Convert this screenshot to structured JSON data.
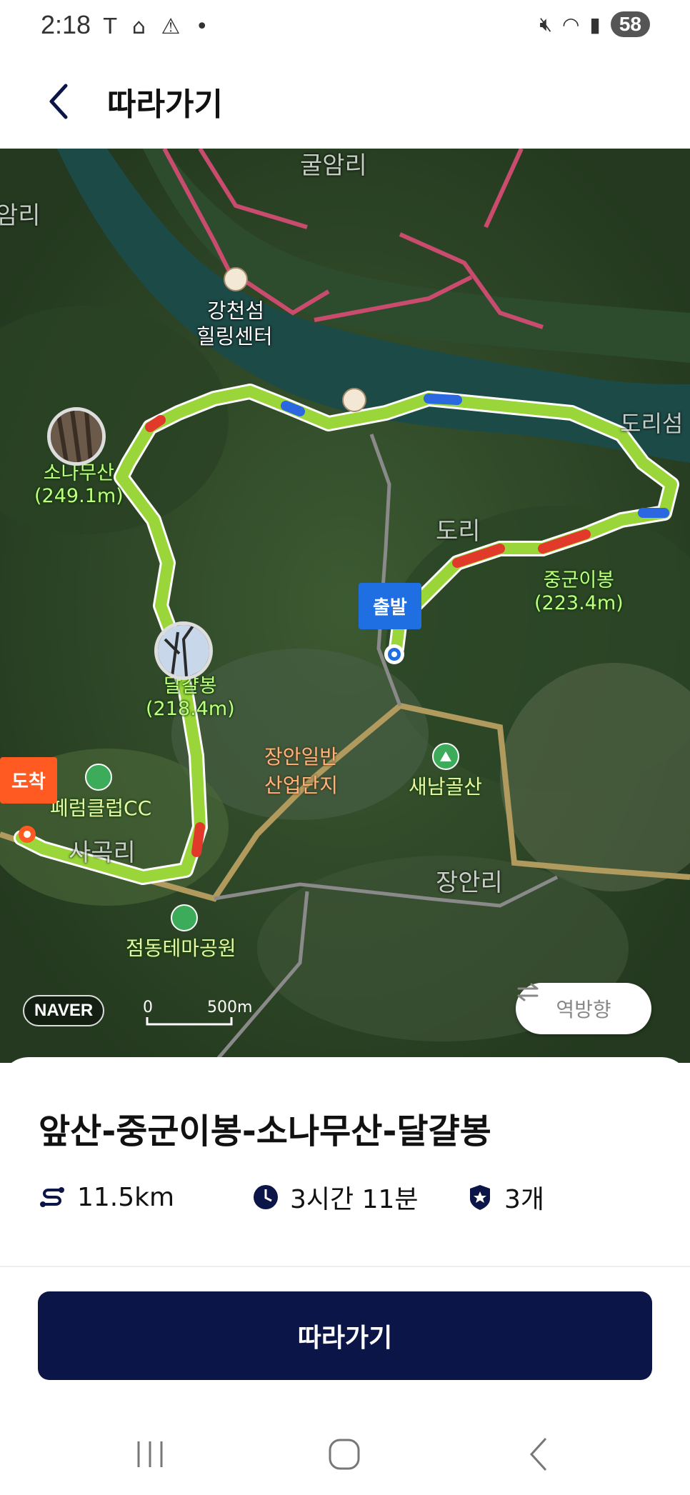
{
  "status_bar": {
    "time": "2:18",
    "left_icons": [
      "T",
      "app-icon",
      "warning-icon",
      "dot"
    ],
    "battery": "58"
  },
  "header": {
    "title": "따라가기"
  },
  "map": {
    "labels": {
      "top_village": "굴암리",
      "left_village": "암리",
      "gangcheon": "강천섬",
      "healing_center": "힐링센터",
      "dori_island": "도리섬",
      "dori": "도리",
      "peak_sonamu": "소나무산",
      "peak_sonamu_height": "(249.1m)",
      "peak_junggun": "중군이봉",
      "peak_junggun_height": "(223.4m)",
      "peak_dalgyal": "달걀봉",
      "peak_dalgyal_height": "(218.4m)",
      "industrial": "장안일반",
      "industrial2": "산업단지",
      "saenamgol": "새남골산",
      "cc": "페럼클럽CC",
      "sagok": "사곡리",
      "jangan": "장안리",
      "park": "점동테마공원"
    },
    "start_label": "출발",
    "end_label": "도착",
    "naver_logo": "NAVER",
    "scale_zero": "0",
    "scale_distance": "500m",
    "reverse_button": "역방향"
  },
  "course": {
    "title": "앞산-중군이봉-소나무산-달걀봉",
    "distance": "11.5km",
    "duration": "3시간 11분",
    "peaks": "3개"
  },
  "follow_button": "따라가기",
  "colors": {
    "primary": "#0c1548",
    "start": "#1f6fe3",
    "end": "#ff5a22",
    "route": "#9ad63a"
  }
}
